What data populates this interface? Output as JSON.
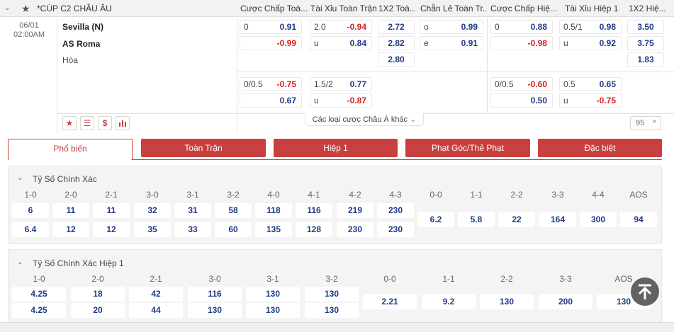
{
  "league": "*CÚP C2 CHÂU ÂU",
  "headers": [
    "Cược Chấp Toà...",
    "Tài Xỉu Toàn Trận",
    "1X2 Toà...",
    "Chẵn Lẻ Toàn Tr...",
    "Cược Chấp Hiệ...",
    "Tài Xỉu Hiệp 1",
    "1X2 Hiệ..."
  ],
  "match": {
    "date": "06/01",
    "time": "02:00AM",
    "home": "Sevilla (N)",
    "away": "AS Roma",
    "draw": "Hòa"
  },
  "rows": {
    "r1": {
      "hcap_l": "0",
      "hcap_v": "0.91",
      "ou_l": "2.0",
      "ou_v": "-0.94",
      "x12": "2.72",
      "oe_l": "o",
      "oe_v": "0.99",
      "hhcap_l": "0",
      "hhcap_v": "0.88",
      "hou_l": "0.5/1",
      "hou_v": "0.98",
      "hx12": "3.50"
    },
    "r2": {
      "hcap_v": "-0.99",
      "ou_l": "u",
      "ou_v": "0.84",
      "x12": "2.82",
      "oe_l": "e",
      "oe_v": "0.91",
      "hhcap_v": "-0.98",
      "hou_l": "u",
      "hou_v": "0.92",
      "hx12": "3.75"
    },
    "r3": {
      "x12": "2.80",
      "hx12": "1.83"
    },
    "r4": {
      "hcap_l": "0/0.5",
      "hcap_v": "-0.75",
      "ou_l": "1.5/2",
      "ou_v": "0.77",
      "hhcap_l": "0/0.5",
      "hhcap_v": "-0.60",
      "hou_l": "0.5",
      "hou_v": "0.65"
    },
    "r5": {
      "hcap_v": "0.67",
      "ou_l": "u",
      "ou_v": "-0.87",
      "hhcap_v": "0.50",
      "hou_l": "u",
      "hou_v": "-0.75"
    }
  },
  "more_bets": "Các loại cược Châu Á khác",
  "more_count": "95",
  "tabs": [
    "Phổ biến",
    "Toàn Trận",
    "Hiệp 1",
    "Phạt Góc/Thẻ Phạt",
    "Đặc biệt"
  ],
  "correct_score": {
    "title": "Tỷ Số Chính Xác",
    "headers": [
      "1-0",
      "2-0",
      "2-1",
      "3-0",
      "3-1",
      "3-2",
      "4-0",
      "4-1",
      "4-2",
      "4-3",
      "0-0",
      "1-1",
      "2-2",
      "3-3",
      "4-4",
      "AOS"
    ],
    "home": [
      "6",
      "11",
      "11",
      "32",
      "31",
      "58",
      "118",
      "116",
      "219",
      "230"
    ],
    "away": [
      "6.4",
      "12",
      "12",
      "35",
      "33",
      "60",
      "135",
      "128",
      "230",
      "230"
    ],
    "draws": [
      "6.2",
      "5.8",
      "22",
      "164",
      "300",
      "94"
    ]
  },
  "correct_score_h1": {
    "title": "Tỷ Số Chính Xác Hiệp 1",
    "headers": [
      "1-0",
      "2-0",
      "2-1",
      "3-0",
      "3-1",
      "3-2",
      "0-0",
      "1-1",
      "2-2",
      "3-3",
      "AOS"
    ],
    "home": [
      "4.25",
      "18",
      "42",
      "116",
      "130",
      "130"
    ],
    "away": [
      "4.25",
      "20",
      "44",
      "130",
      "130",
      "130"
    ],
    "draws": [
      "2.21",
      "9.2",
      "130",
      "200",
      "130"
    ]
  }
}
